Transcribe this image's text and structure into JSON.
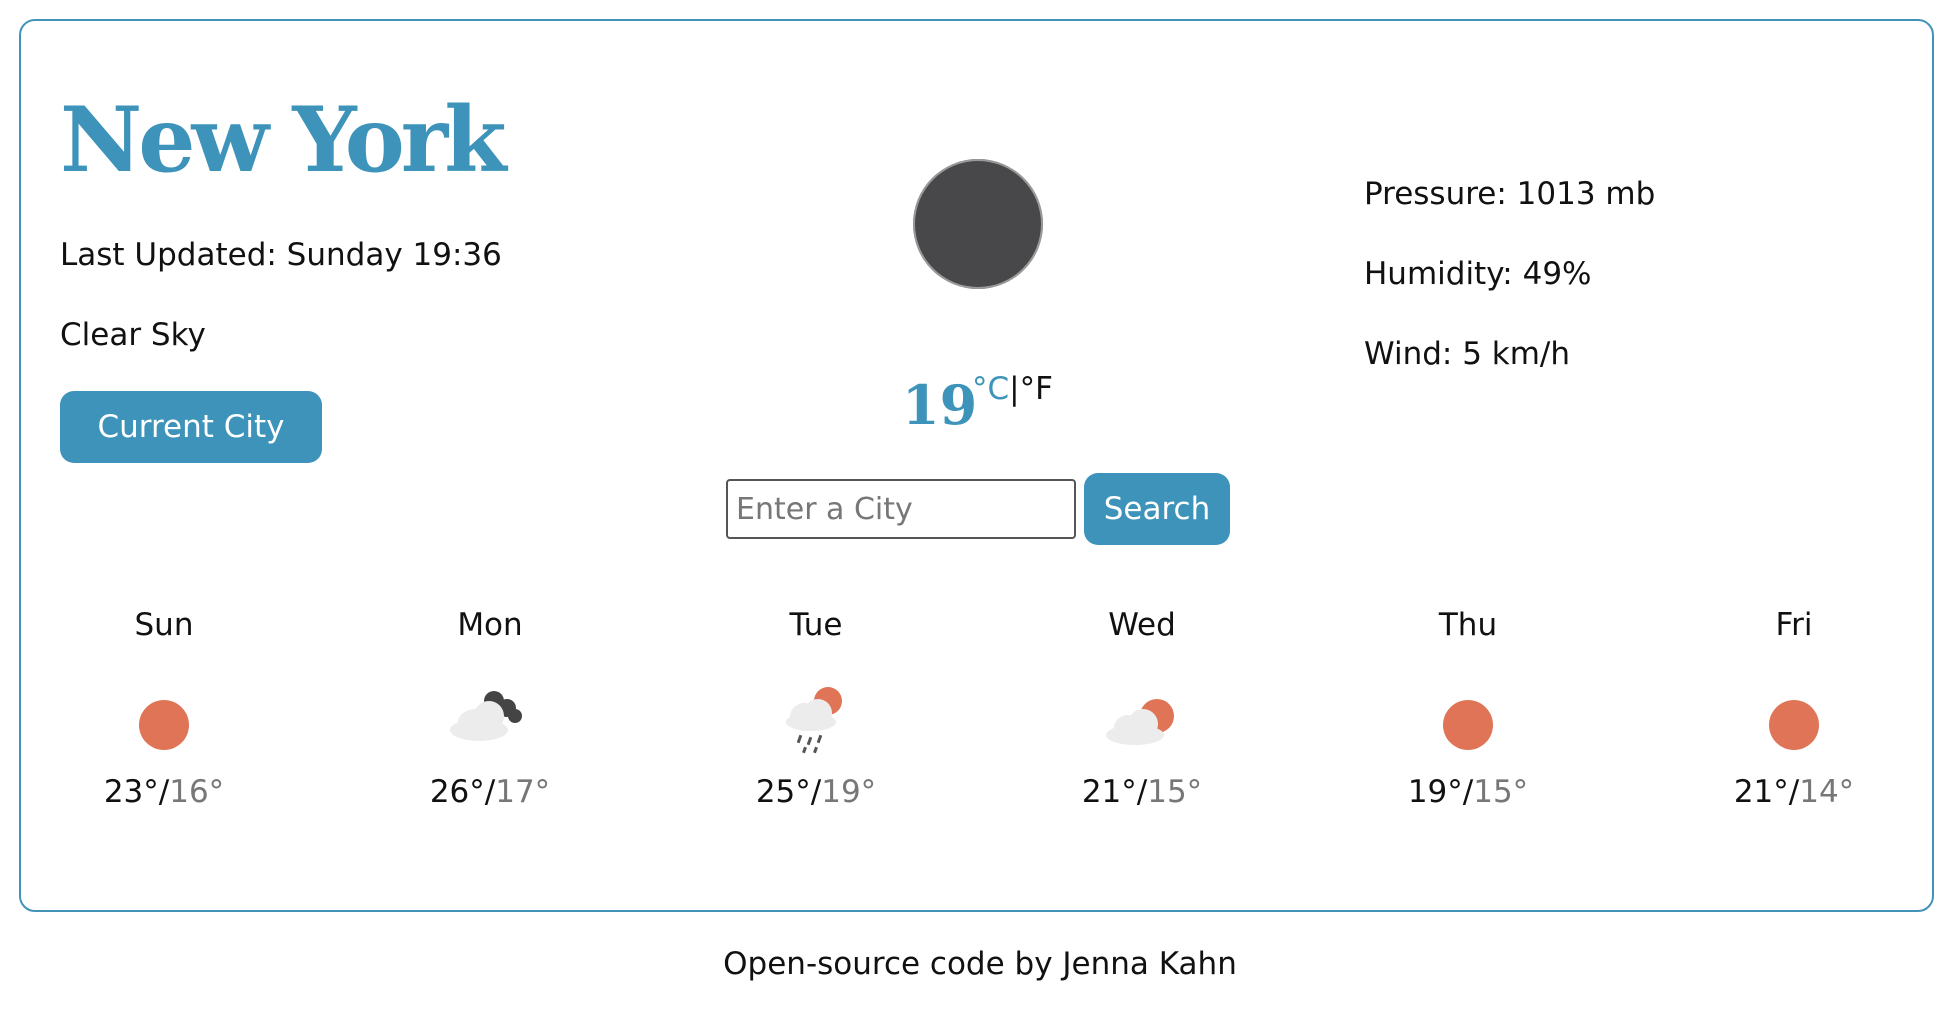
{
  "weather": {
    "city": "New York",
    "last_updated": "Last Updated: Sunday 19:36",
    "description": "Clear Sky",
    "current_city_button": "Current City",
    "main_icon": "clear-night-icon",
    "temperature": "19",
    "unit_celsius": "°C",
    "unit_separator": "|",
    "unit_fahrenheit": "°F",
    "pressure": "Pressure: 1013 mb",
    "humidity": "Humidity: 49%",
    "wind": "Wind: 5 km/h"
  },
  "search": {
    "placeholder": "Enter a City",
    "value": "",
    "button_label": "Search"
  },
  "forecast": [
    {
      "day": "Sun",
      "icon": "sun-icon",
      "max": "23°",
      "sep": "/",
      "min": "16°"
    },
    {
      "day": "Mon",
      "icon": "broken-clouds-icon",
      "max": "26°",
      "sep": "/",
      "min": "17°"
    },
    {
      "day": "Tue",
      "icon": "rain-icon",
      "max": "25°",
      "sep": "/",
      "min": "19°"
    },
    {
      "day": "Wed",
      "icon": "partly-cloudy-icon",
      "max": "21°",
      "sep": "/",
      "min": "15°"
    },
    {
      "day": "Thu",
      "icon": "sun-icon",
      "max": "19°",
      "sep": "/",
      "min": "15°"
    },
    {
      "day": "Fri",
      "icon": "sun-icon",
      "max": "21°",
      "sep": "/",
      "min": "14°"
    }
  ],
  "footer": {
    "text": "Open-source code by Jenna Kahn"
  },
  "colors": {
    "accent": "#3d93b9",
    "sun": "#df7556",
    "night_icon": "#48484a"
  }
}
